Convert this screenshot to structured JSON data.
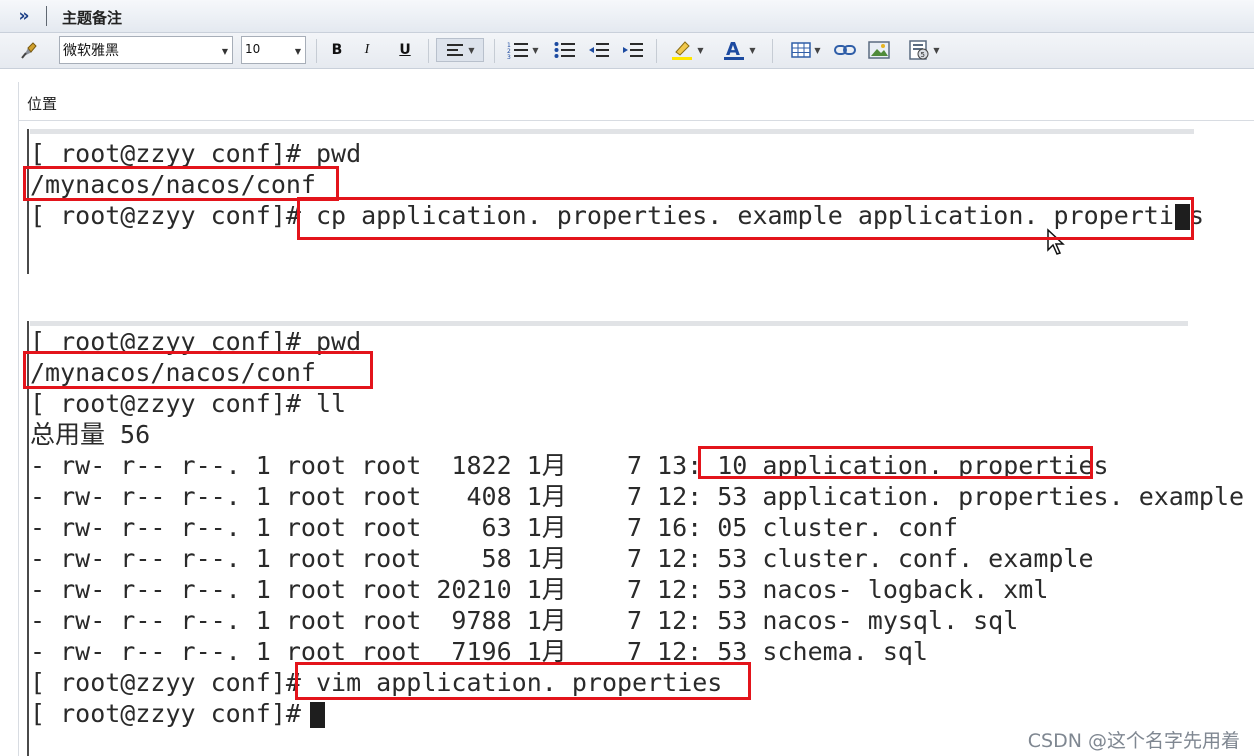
{
  "panel": {
    "title": "主题备注",
    "collapse_glyph": "»"
  },
  "toolbar": {
    "font_name": "微软雅黑",
    "font_size": "10",
    "bold_label": "B",
    "italic_label": "I",
    "underline_label": "U",
    "font_color_label": "A"
  },
  "location": {
    "label": "位置"
  },
  "terminal_top": {
    "lines": [
      "[ root@zzyy conf]# pwd",
      "/mynacos/nacos/conf",
      "[ root@zzyy conf]# cp application. properties. example application. properties"
    ]
  },
  "terminal_bottom": {
    "lines": [
      "[ root@zzyy conf]# pwd",
      "/mynacos/nacos/conf",
      "[ root@zzyy conf]# ll",
      "总用量 56",
      "- rw- r-- r--. 1 root root  1822 1月    7 13: 10 application. properties",
      "- rw- r-- r--. 1 root root   408 1月    7 12: 53 application. properties. example",
      "- rw- r-- r--. 1 root root    63 1月    7 16: 05 cluster. conf",
      "- rw- r-- r--. 1 root root    58 1月    7 12: 53 cluster. conf. example",
      "- rw- r-- r--. 1 root root 20210 1月    7 12: 53 nacos- logback. xml",
      "- rw- r-- r--. 1 root root  9788 1月    7 12: 53 nacos- mysql. sql",
      "- rw- r-- r--. 1 root root  7196 1月    7 12: 53 schema. sql",
      "[ root@zzyy conf]# vim application. properties",
      "[ root@zzyy conf]# "
    ]
  },
  "watermark": "CSDN @这个名字先用着",
  "colors": {
    "highlight_box": "#e3141b",
    "toolbar_bg": "#e6eaf0",
    "text": "#2a2a2a"
  },
  "icons": [
    "pin-icon",
    "numbered-list-icon",
    "bullet-list-icon",
    "outdent-icon",
    "indent-icon",
    "highlighter-icon",
    "font-color-icon",
    "table-icon",
    "link-icon",
    "image-icon",
    "attachment-icon"
  ]
}
